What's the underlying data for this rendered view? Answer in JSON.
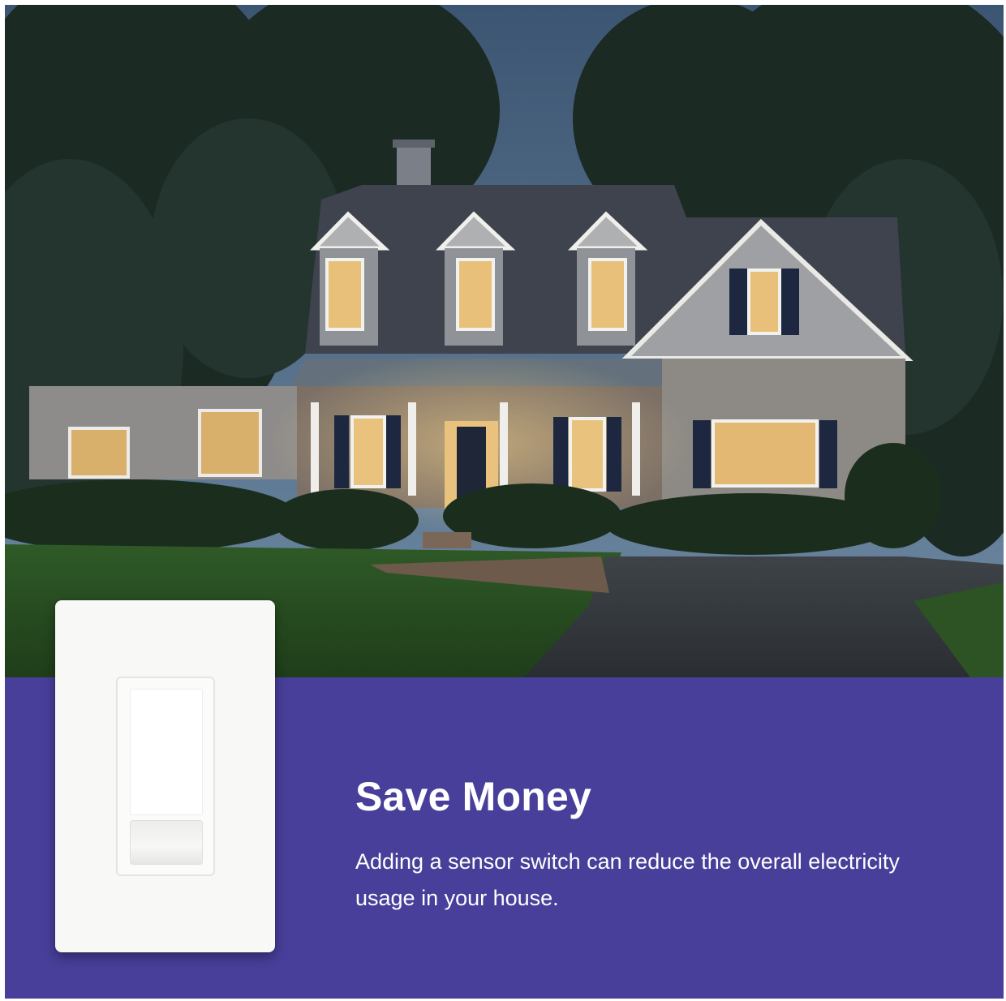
{
  "headline": "Save Money",
  "body": "Adding a sensor switch can reduce the overall electricity usage in your house.",
  "colors": {
    "panel_background": "#473f99",
    "text": "#ffffff",
    "switch_plate": "#f8f8f6"
  },
  "images": {
    "house_photo": "house-at-dusk-illustration",
    "product": "motion-sensor-light-switch"
  }
}
